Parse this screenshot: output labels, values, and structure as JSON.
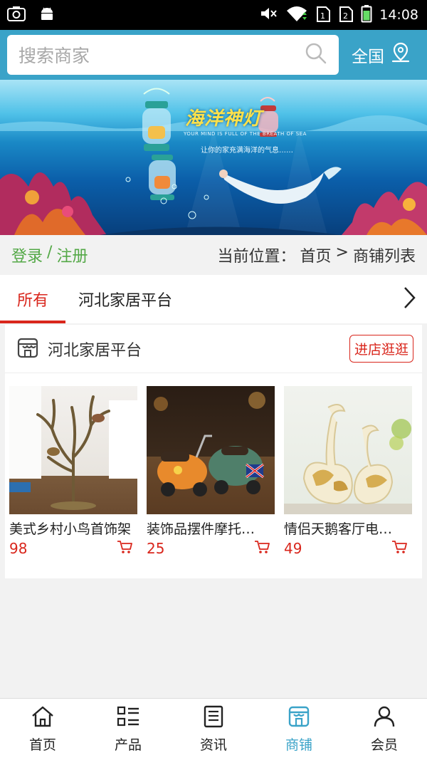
{
  "status_bar": {
    "time": "14:08",
    "icons": [
      "screenshot-icon",
      "android-icon",
      "mute-icon",
      "wifi-icon",
      "sim1-icon",
      "sim2-icon",
      "battery-icon"
    ]
  },
  "header": {
    "search_placeholder": "搜索商家",
    "region_label": "全国"
  },
  "banner": {
    "title": "海洋神灯",
    "subtitle_en": "YOUR MIND IS FULL OF THE BREATH OF SEA",
    "subtitle_cn": "让你的家充满海洋的气息……"
  },
  "login": {
    "login_label": "登录",
    "separator": "/",
    "register_label": "注册"
  },
  "breadcrumb": {
    "prefix": "当前位置：",
    "home": "首页",
    "sep": ">",
    "current": "商铺列表"
  },
  "tabs": [
    {
      "label": "所有",
      "active": true
    },
    {
      "label": "河北家居平台",
      "active": false
    }
  ],
  "shop": {
    "name": "河北家居平台",
    "visit_label": "进店逛逛",
    "products": [
      {
        "name": "美式乡村小鸟首饰架",
        "price": "98"
      },
      {
        "name": "装饰品摆件摩托…",
        "price": "25"
      },
      {
        "name": "情侣天鹅客厅电…",
        "price": "49"
      }
    ]
  },
  "bottom_nav": [
    {
      "label": "首页",
      "icon": "home-icon",
      "active": false
    },
    {
      "label": "产品",
      "icon": "grid-list-icon",
      "active": false
    },
    {
      "label": "资讯",
      "icon": "news-icon",
      "active": false
    },
    {
      "label": "商铺",
      "icon": "store-icon",
      "active": true
    },
    {
      "label": "会员",
      "icon": "user-icon",
      "active": false
    }
  ],
  "colors": {
    "accent": "#3aa3c8",
    "price_red": "#d9261c",
    "login_green": "#53a846"
  }
}
